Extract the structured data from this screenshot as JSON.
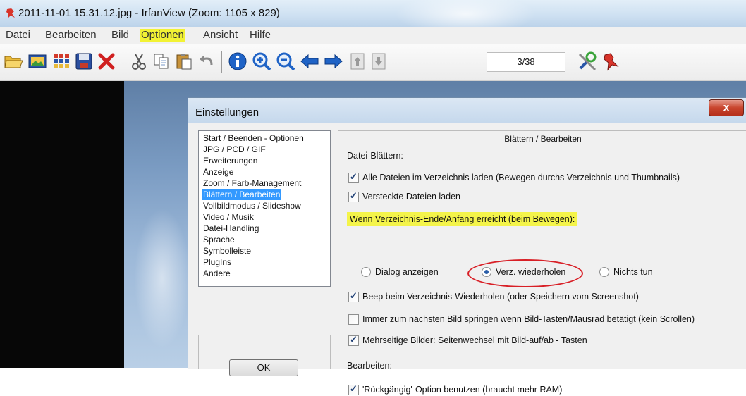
{
  "window": {
    "title": "2011-11-01 15.31.12.jpg - IrfanView (Zoom: 1105 x 829)"
  },
  "menu": {
    "items": [
      "Datei",
      "Bearbeiten",
      "Bild",
      "Optionen",
      "Ansicht",
      "Hilfe"
    ],
    "highlighted": "Optionen"
  },
  "toolbar": {
    "icons": [
      "open-folder-icon",
      "slideshow-icon",
      "thumbnails-icon",
      "save-icon",
      "delete-icon",
      "cut-icon",
      "copy-icon",
      "paste-icon",
      "undo-icon",
      "info-icon",
      "zoom-in-icon",
      "zoom-out-icon",
      "previous-icon",
      "next-icon",
      "first-page-icon",
      "last-page-icon",
      "properties-icon",
      "exit-icon"
    ],
    "page_counter": "3/38"
  },
  "dialog": {
    "title": "Einstellungen",
    "close_label": "x",
    "categories": [
      "Start / Beenden - Optionen",
      "JPG / PCD / GIF",
      "Erweiterungen",
      "Anzeige",
      "Zoom / Farb-Management",
      "Blättern / Bearbeiten",
      "Vollbildmodus / Slideshow",
      "Video / Musik",
      "Datei-Handling",
      "Sprache",
      "Symbolleiste",
      "PlugIns",
      "Andere"
    ],
    "selected_category": "Blättern / Bearbeiten",
    "ok_label": "OK",
    "panel": {
      "header": "Blättern / Bearbeiten",
      "section_browse": "Datei-Blättern:",
      "options": [
        {
          "label": "Alle Dateien im Verzeichnis laden (Bewegen durchs Verzeichnis und Thumbnails)",
          "checked": true
        },
        {
          "label": "Versteckte Dateien laden",
          "checked": true
        }
      ],
      "end_label": "Wenn Verzeichnis-Ende/Anfang erreicht (beim Bewegen):",
      "radios": [
        {
          "label": "Dialog anzeigen",
          "selected": false
        },
        {
          "label": "Verz. wiederholen",
          "selected": true
        },
        {
          "label": "Nichts tun",
          "selected": false
        }
      ],
      "more_options": [
        {
          "label": "Beep beim Verzeichnis-Wiederholen (oder Speichern vom Screenshot)",
          "checked": true
        },
        {
          "label": "Immer zum nächsten Bild springen wenn Bild-Tasten/Mausrad betätigt (kein Scrollen)",
          "checked": false
        },
        {
          "label": "Mehrseitige Bilder: Seitenwechsel mit Bild-auf/ab - Tasten",
          "checked": true
        }
      ],
      "section_edit": "Bearbeiten:",
      "edit_options": [
        {
          "label": "'Rückgängig'-Option benutzen (braucht mehr RAM)",
          "checked": true
        }
      ]
    }
  },
  "colors": {
    "menu_highlight": "#f2f234",
    "selection": "#3399ff",
    "annotation_red": "#d81f26"
  }
}
